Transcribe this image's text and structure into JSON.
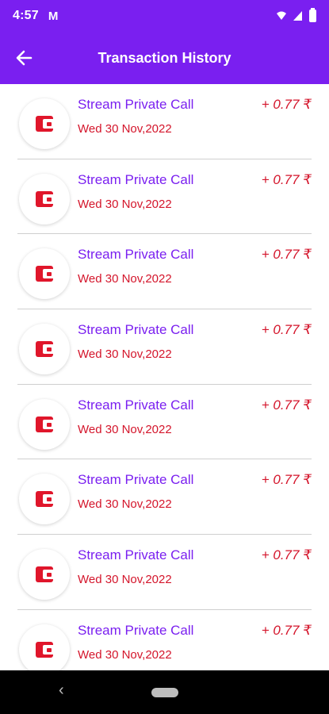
{
  "status_bar": {
    "time": "4:57",
    "mail_glyph": "M",
    "icons": [
      "wifi-icon",
      "signal-icon",
      "battery-icon"
    ]
  },
  "app_bar": {
    "title": "Transaction History",
    "back_icon": "arrow-back-icon",
    "color": "#7a1ff0"
  },
  "transactions": [
    {
      "title": "Stream Private Call",
      "date": "Wed 30 Nov,2022",
      "amount": "+ 0.77 ₹",
      "icon": "wallet-icon"
    },
    {
      "title": "Stream Private Call",
      "date": "Wed 30 Nov,2022",
      "amount": "+ 0.77 ₹",
      "icon": "wallet-icon"
    },
    {
      "title": "Stream Private Call",
      "date": "Wed 30 Nov,2022",
      "amount": "+ 0.77 ₹",
      "icon": "wallet-icon"
    },
    {
      "title": "Stream Private Call",
      "date": "Wed 30 Nov,2022",
      "amount": "+ 0.77 ₹",
      "icon": "wallet-icon"
    },
    {
      "title": "Stream Private Call",
      "date": "Wed 30 Nov,2022",
      "amount": "+ 0.77 ₹",
      "icon": "wallet-icon"
    },
    {
      "title": "Stream Private Call",
      "date": "Wed 30 Nov,2022",
      "amount": "+ 0.77 ₹",
      "icon": "wallet-icon"
    },
    {
      "title": "Stream Private Call",
      "date": "Wed 30 Nov,2022",
      "amount": "+ 0.77 ₹",
      "icon": "wallet-icon"
    },
    {
      "title": "Stream Private Call",
      "date": "Wed 30 Nov,2022",
      "amount": "+ 0.77 ₹",
      "icon": "wallet-icon"
    }
  ],
  "colors": {
    "accent": "#7a1ff0",
    "amount": "#d4152b",
    "wallet": "#e0162b"
  },
  "nav_bar": {
    "back_glyph": "‹"
  }
}
